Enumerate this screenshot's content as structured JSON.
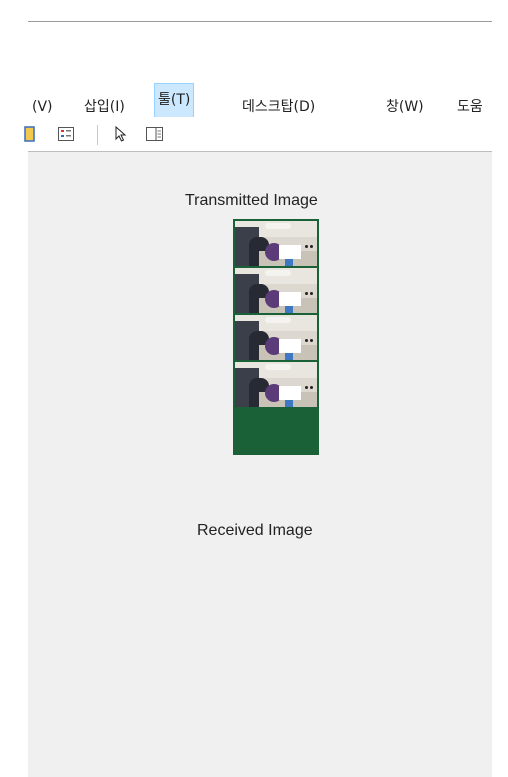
{
  "menubar": {
    "items": [
      {
        "label": "(V)"
      },
      {
        "label": "삽입(I)"
      },
      {
        "label": "툴(T)"
      },
      {
        "label": "데스크탑(D)"
      },
      {
        "label": "창(W)"
      },
      {
        "label": "도움"
      }
    ],
    "active_index": 2
  },
  "toolbar": {
    "buttons": [
      {
        "icon": "color-box-icon"
      },
      {
        "icon": "legend-icon"
      },
      {
        "icon": "cursor-arrow-icon"
      },
      {
        "icon": "property-inspector-icon"
      }
    ]
  },
  "figure": {
    "transmitted_title": "Transmitted Image",
    "received_title": "Received Image",
    "frame_count": 4,
    "colors": {
      "background": "#f0f0f0",
      "frame_border": "#1a6138",
      "menu_highlight": "#cce8ff"
    }
  }
}
